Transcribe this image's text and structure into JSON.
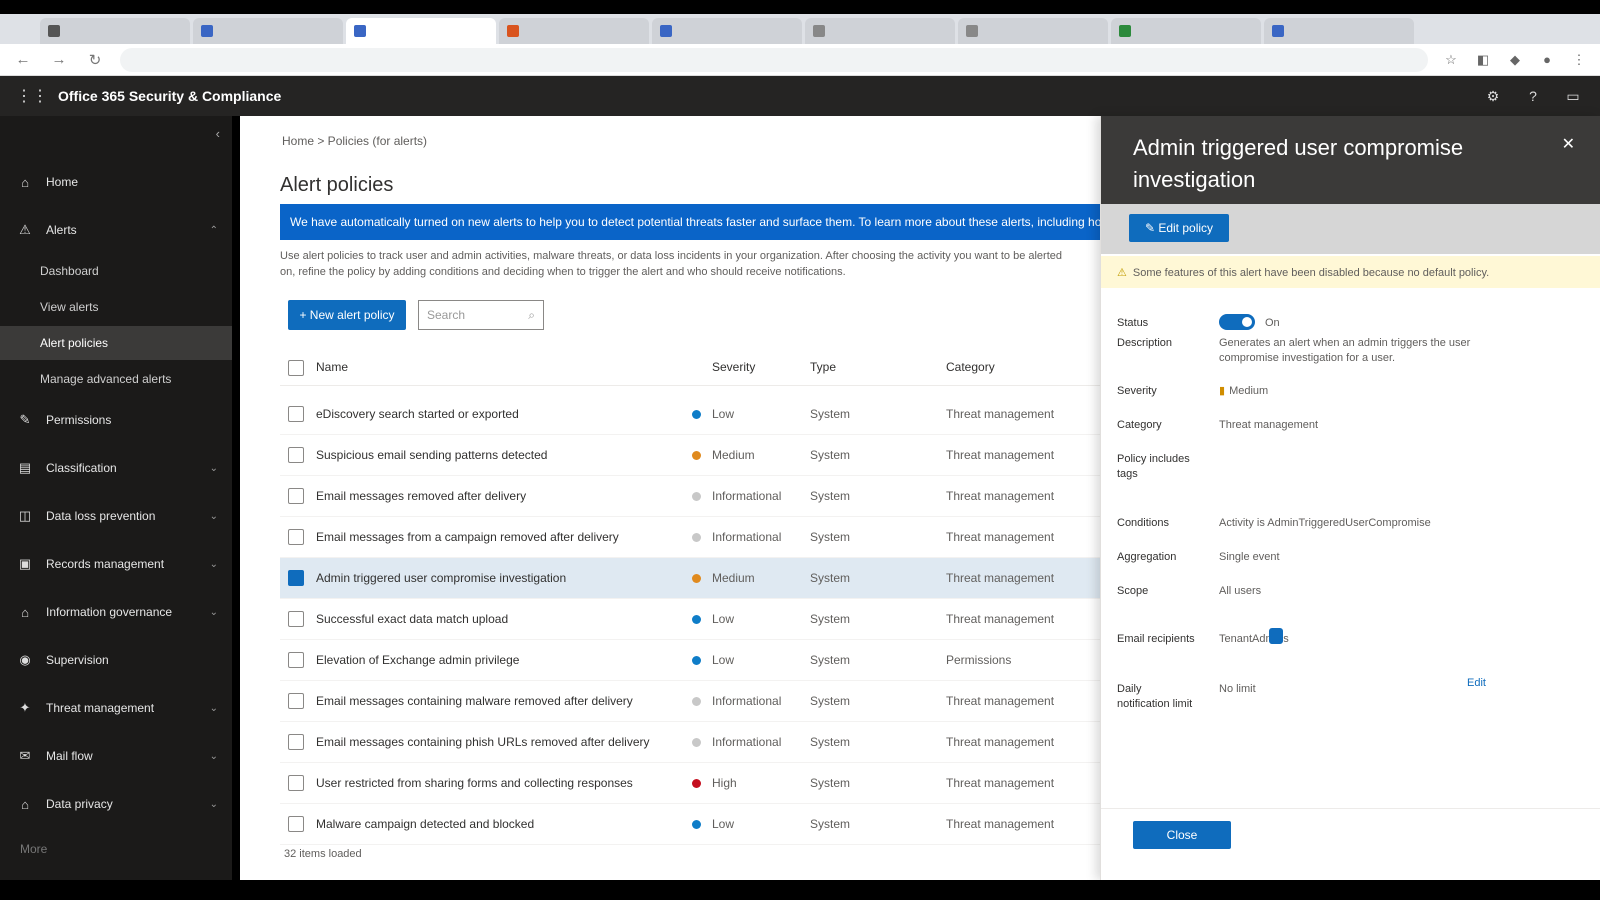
{
  "browser": {
    "tabs": [
      {
        "label": "",
        "color": "#555555",
        "active": false
      },
      {
        "label": "",
        "color": "#3a66c4",
        "active": false
      },
      {
        "label": "",
        "color": "#3a66c4",
        "active": true
      },
      {
        "label": "",
        "color": "#d9541e",
        "active": false
      },
      {
        "label": "",
        "color": "#3a66c4",
        "active": false
      },
      {
        "label": "",
        "color": "#888888",
        "active": false
      },
      {
        "label": "",
        "color": "#888888",
        "active": false
      },
      {
        "label": "",
        "color": "#2c8a3c",
        "active": false
      },
      {
        "label": "",
        "color": "#3a66c4",
        "active": false
      }
    ],
    "url": ""
  },
  "app": {
    "title": "Office 365 Security & Compliance"
  },
  "nav": {
    "items": [
      {
        "label": "Home",
        "icon": "home-icon",
        "glyph": "⌂",
        "chevron": false
      },
      {
        "label": "Alerts",
        "icon": "alert-icon",
        "glyph": "⚠",
        "chevron": true
      },
      {
        "label": "Permissions",
        "icon": "key-icon",
        "glyph": "✎",
        "chevron": false
      },
      {
        "label": "Classification",
        "icon": "tag-icon",
        "glyph": "▤",
        "chevron": true
      },
      {
        "label": "Data loss prevention",
        "icon": "shield-icon",
        "glyph": "◫",
        "chevron": true
      },
      {
        "label": "Records management",
        "icon": "records-icon",
        "glyph": "▣",
        "chevron": true
      },
      {
        "label": "Information governance",
        "icon": "lock-icon",
        "glyph": "⌂",
        "chevron": true
      },
      {
        "label": "Supervision",
        "icon": "eye-icon",
        "glyph": "◉",
        "chevron": false
      },
      {
        "label": "Threat management",
        "icon": "threat-icon",
        "glyph": "✦",
        "chevron": true
      },
      {
        "label": "Mail flow",
        "icon": "mail-icon",
        "glyph": "✉",
        "chevron": true
      },
      {
        "label": "Data privacy",
        "icon": "privacy-icon",
        "glyph": "⌂",
        "chevron": true
      }
    ],
    "alerts_subitems": [
      "Dashboard",
      "View alerts",
      "Alert policies",
      "Manage advanced alerts"
    ],
    "more": "More"
  },
  "main": {
    "breadcrumb": "Home  >  Policies (for alerts)",
    "title": "Alert policies",
    "banner": "We have automatically turned on new alerts to help you to detect potential threats faster and surface them. To learn more about these alerts, including how to manage and adjust them, see the documentation.",
    "description": "Use alert policies to track user and admin activities, malware threats, or data loss incidents in your organization. After choosing the activity you want to be alerted on, refine the policy by adding conditions and deciding when to trigger the alert and who should receive notifications.",
    "new_button": "+ New alert policy",
    "search_placeholder": "Search",
    "columns": {
      "name": "Name",
      "severity": "Severity",
      "type": "Type",
      "category": "Category"
    },
    "rows": [
      {
        "name": "eDiscovery search started or exported",
        "severity": "Low",
        "sev_color": "#0f7dc8",
        "type": "System",
        "category": "Threat management",
        "selected": false
      },
      {
        "name": "Suspicious email sending patterns detected",
        "severity": "Medium",
        "sev_color": "#e08a1e",
        "type": "System",
        "category": "Threat management",
        "selected": false
      },
      {
        "name": "Email messages removed after delivery",
        "severity": "Informational",
        "sev_color": "#c8c8c8",
        "type": "System",
        "category": "Threat management",
        "selected": false
      },
      {
        "name": "Email messages from a campaign removed after delivery",
        "severity": "Informational",
        "sev_color": "#c8c8c8",
        "type": "System",
        "category": "Threat management",
        "selected": false
      },
      {
        "name": "Admin triggered user compromise investigation",
        "severity": "Medium",
        "sev_color": "#e08a1e",
        "type": "System",
        "category": "Threat management",
        "selected": true
      },
      {
        "name": "Successful exact data match upload",
        "severity": "Low",
        "sev_color": "#0f7dc8",
        "type": "System",
        "category": "Threat management",
        "selected": false
      },
      {
        "name": "Elevation of Exchange admin privilege",
        "severity": "Low",
        "sev_color": "#0f7dc8",
        "type": "System",
        "category": "Permissions",
        "selected": false
      },
      {
        "name": "Email messages containing malware removed after delivery",
        "severity": "Informational",
        "sev_color": "#c8c8c8",
        "type": "System",
        "category": "Threat management",
        "selected": false
      },
      {
        "name": "Email messages containing phish URLs removed after delivery",
        "severity": "Informational",
        "sev_color": "#c8c8c8",
        "type": "System",
        "category": "Threat management",
        "selected": false
      },
      {
        "name": "User restricted from sharing forms and collecting responses",
        "severity": "High",
        "sev_color": "#c50f1f",
        "type": "System",
        "category": "Threat management",
        "selected": false
      },
      {
        "name": "Malware campaign detected and blocked",
        "severity": "Low",
        "sev_color": "#0f7dc8",
        "type": "System",
        "category": "Threat management",
        "selected": false
      }
    ],
    "footer": "32 items loaded"
  },
  "flyout": {
    "title": "Admin triggered user compromise investigation",
    "edit_button": "✎ Edit policy",
    "warning": "Some features of this alert have been disabled because no default policy.",
    "status_label": "Status",
    "status_value": "On",
    "description_label": "Description",
    "description_value": "Generates an alert when an admin triggers the user compromise investigation for a user.",
    "severity_label": "Severity",
    "severity_value": "Medium",
    "category_label": "Category",
    "category_value": "Threat management",
    "filter_label": "Policy includes tags",
    "conditions_label": "Conditions",
    "conditions_value": "Activity is AdminTriggeredUserCompromise",
    "aggregation_label": "Aggregation",
    "aggregation_value": "Single event",
    "scope_label": "Scope",
    "scope_value": "All users",
    "email_label": "Email recipients",
    "email_value": "TenantAdmins",
    "limit_label": "Daily notification limit",
    "limit_value": "No limit",
    "limit_link": "Edit",
    "close_button": "Close"
  }
}
